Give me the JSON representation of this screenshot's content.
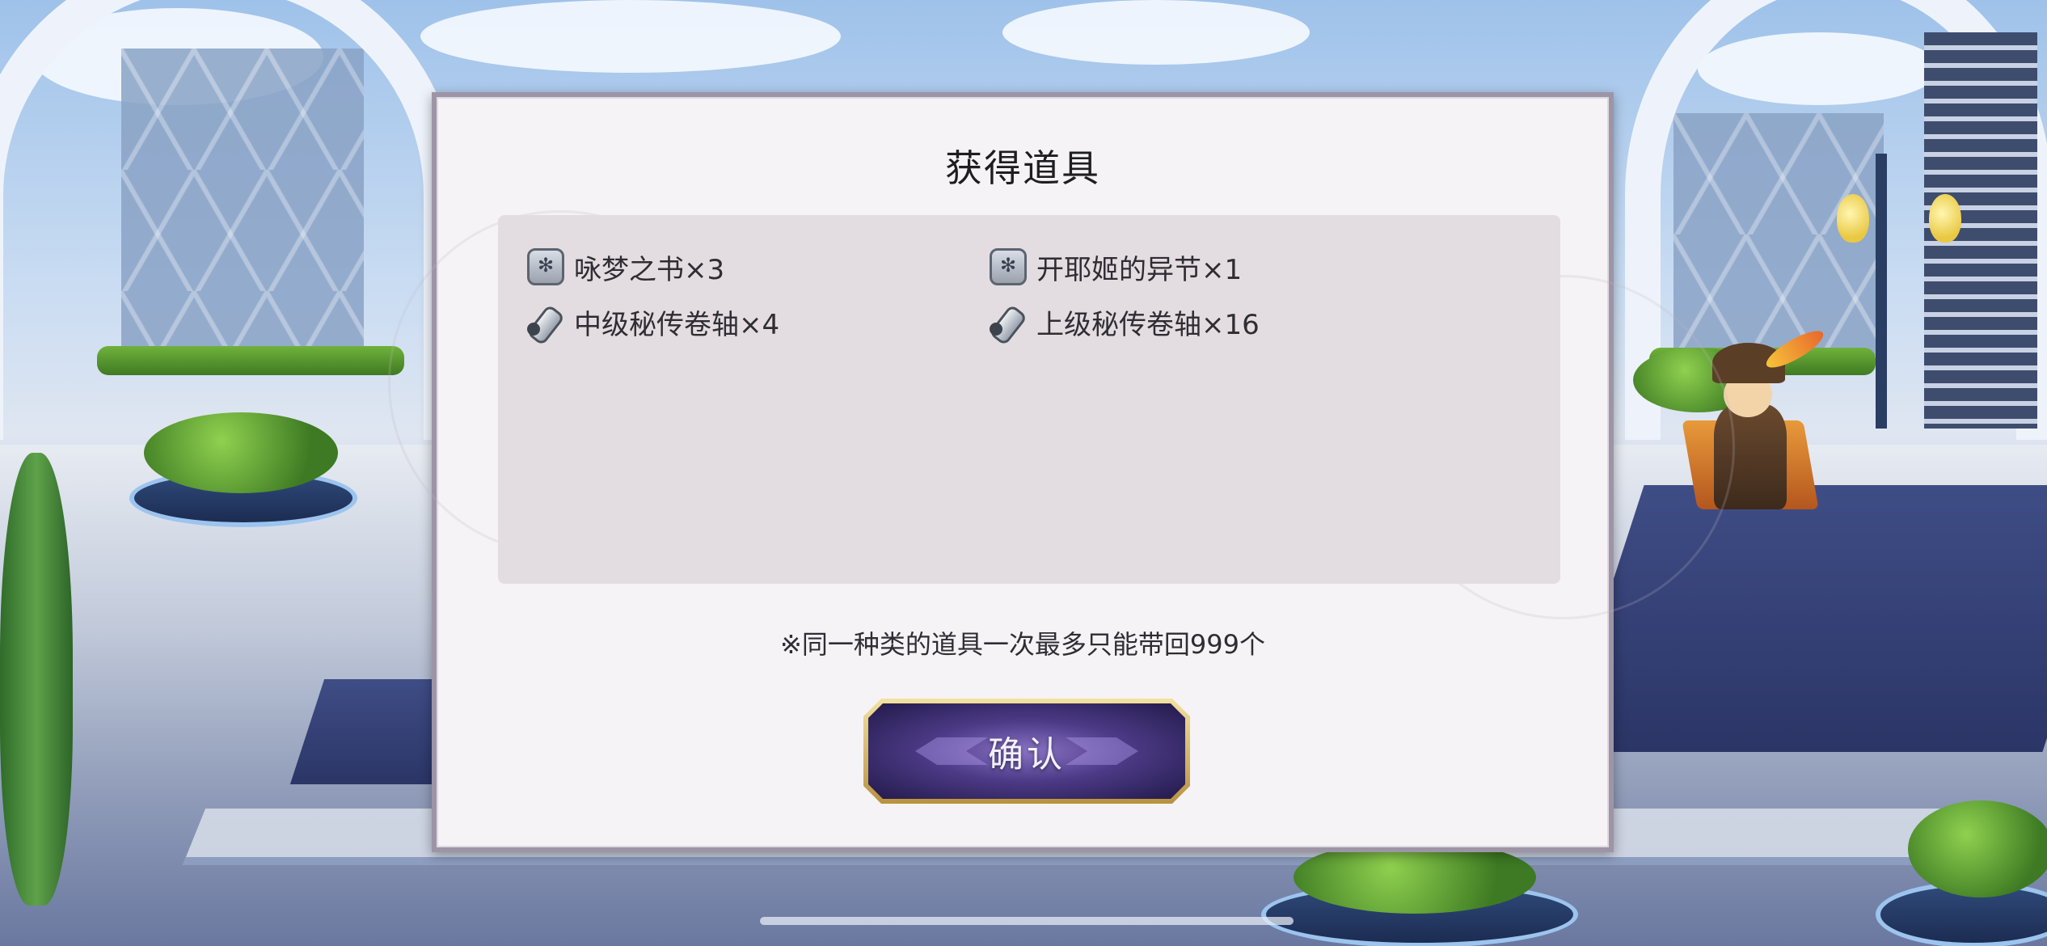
{
  "dialog": {
    "title": "获得道具",
    "items": [
      {
        "icon": "book-icon",
        "label": "咏梦之书×3"
      },
      {
        "icon": "book-icon",
        "label": "开耶姬的异节×1"
      },
      {
        "icon": "scroll-icon",
        "label": "中级秘传卷轴×4"
      },
      {
        "icon": "scroll-icon",
        "label": "上级秘传卷轴×16"
      }
    ],
    "notice": "※同一种类的道具一次最多只能带回999个",
    "confirm_label": "确认"
  }
}
